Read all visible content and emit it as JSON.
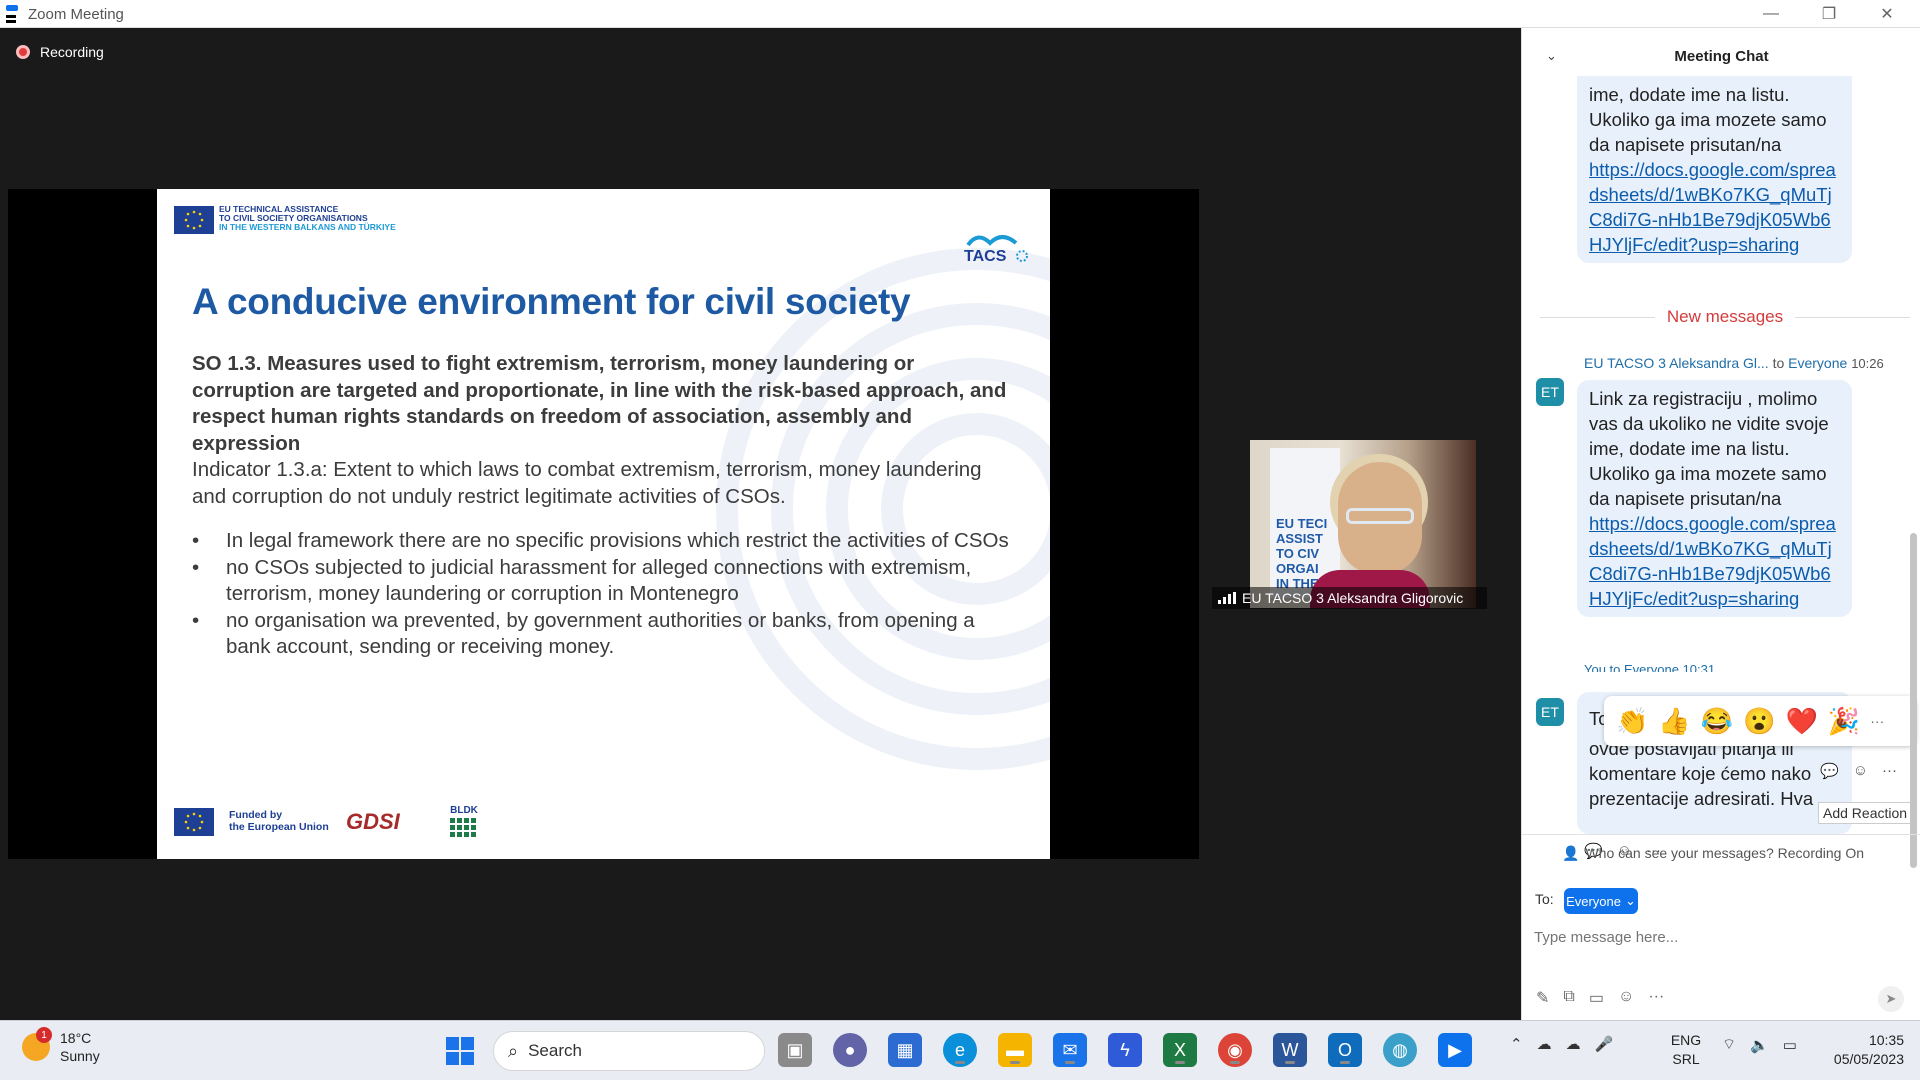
{
  "window": {
    "title": "Zoom Meeting",
    "controls": [
      "minimize",
      "restore",
      "close"
    ]
  },
  "recording": {
    "label": "Recording"
  },
  "slide": {
    "eu_org": [
      "EU TECHNICAL ASSISTANCE",
      "TO CIVIL SOCIETY ORGANISATIONS",
      "IN THE WESTERN BALKANS AND TÜRKIYE"
    ],
    "logo": "TACSO",
    "title": "A conducive environment for civil society",
    "so_heading": "SO 1.3.   Measures used to fight extremism, terrorism, money laundering or corruption are targeted and proportionate, in line with the risk-based approach, and respect human rights standards on freedom of association, assembly and expression",
    "indicator": "Indicator 1.3.a:     Extent to which laws to combat extremism, terrorism, money laundering and corruption do not unduly restrict legitimate activities of CSOs.",
    "bullets": [
      "In legal framework there are no specific provisions which restrict the activities of CSOs",
      "no CSOs subjected to judicial harassment for alleged connections with extremism, terrorism, money laundering or corruption in Montenegro",
      "no organisation wa prevented, by government authorities or banks, from opening a bank account, sending or receiving money."
    ],
    "footer": {
      "funded": "Funded by",
      "funded2": "the European Union",
      "partner1": "GDSI",
      "partner2": "BLDK"
    }
  },
  "video": {
    "participant": "EU TACSO 3 Aleksandra Gligorovic"
  },
  "chat": {
    "title": "Meeting Chat",
    "prev_message": {
      "lines": [
        "ime, dodate ime na listu.",
        "Ukoliko ga ima mozete samo da napisete prisutan/na"
      ],
      "link": "https://docs.google.com/spreadsheets/d/1wBKo7KG_qMuTjC8di7G-nHb1Be79djK05Wb6HJYljFc/edit?usp=sharing"
    },
    "new_messages_label": "New messages",
    "msg1": {
      "sender": "EU TACSO 3 Aleksandra Gl...",
      "to": "to",
      "recipient": "Everyone",
      "time": "10:26",
      "avatar": "ET",
      "text": "Link za registraciju , molimo vas da ukoliko ne vidite svoje ime, dodate ime na listu. Ukoliko ga ima mozete samo da napisete prisutan/na",
      "link": "https://docs.google.com/spreadsheets/d/1wBKo7KG_qMuTjC8di7G-nHb1Be79djK05Wb6HJYljFc/edit?usp=sharing"
    },
    "msg2": {
      "sender": "You to Everyone",
      "time": "10:31",
      "avatar": "ET",
      "text_fragments": [
        "To",
        "ovde postavljati pitanja ili",
        "komentare koje ćemo nako",
        "prezentacije adresirati. Hva"
      ]
    },
    "reactions": [
      "👏",
      "👍",
      "😂",
      "😮",
      "❤️",
      "🎉"
    ],
    "reactions_more": "···",
    "tooltip": "Add Reaction",
    "privacy": "Who can see your messages? Recording On",
    "to_label": "To:",
    "recipient_button": "Everyone",
    "input_placeholder": "Type message here..."
  },
  "taskbar": {
    "weather": {
      "temp": "18°C",
      "condition": "Sunny",
      "badge": "1"
    },
    "search_placeholder": "Search",
    "language": [
      "ENG",
      "SRL"
    ],
    "time": "10:35",
    "date": "05/05/2023",
    "apps": [
      "windows-start",
      "task-view",
      "teams-chat",
      "store",
      "edge",
      "file-explorer",
      "mail",
      "power-automate",
      "excel",
      "chrome",
      "word",
      "outlook",
      "maps",
      "zoom"
    ]
  },
  "colors": {
    "zoom_blue": "#0e72ed",
    "slide_title": "#1d5aa3",
    "eu_blue": "#1d3f94",
    "new_messages": "#d23c3c"
  }
}
